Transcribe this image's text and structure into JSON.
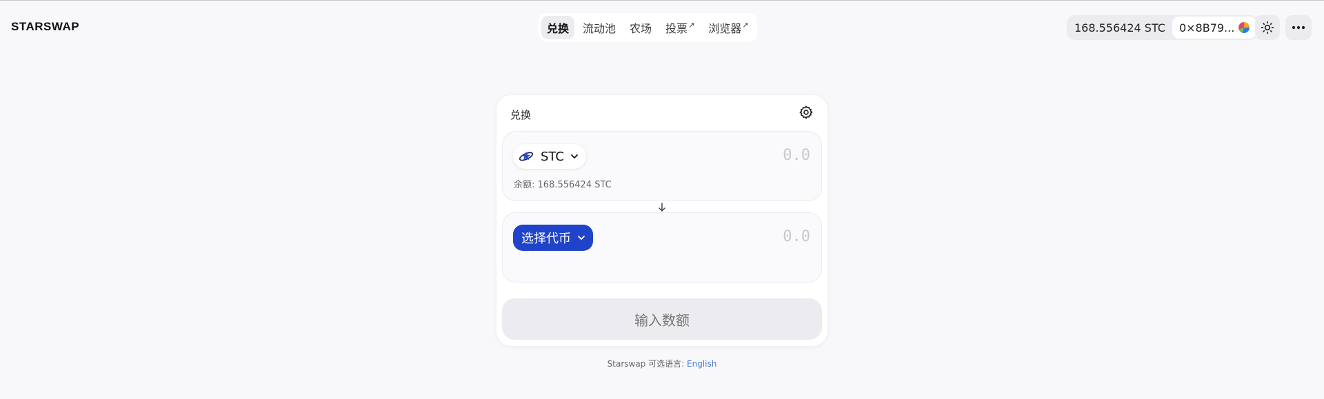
{
  "app": {
    "logo": "STARSWAP"
  },
  "nav": {
    "items": [
      {
        "label": "兑换",
        "active": true,
        "external": false
      },
      {
        "label": "流动池",
        "active": false,
        "external": false
      },
      {
        "label": "农场",
        "active": false,
        "external": false
      },
      {
        "label": "投票",
        "active": false,
        "external": true
      },
      {
        "label": "浏览器",
        "active": false,
        "external": true
      }
    ],
    "external_glyph": "↗"
  },
  "account": {
    "balance": "168.556424 STC",
    "address": "0×8B79..."
  },
  "header_icons": {
    "theme": "sun-icon",
    "more": "more-dots-icon"
  },
  "swap": {
    "title": "兑换",
    "from": {
      "token": "STC",
      "amount_placeholder": "0.0",
      "balance_label": "余额:",
      "balance_value": "168.556424 STC"
    },
    "to": {
      "select_label": "选择代币",
      "amount_placeholder": "0.0"
    },
    "submit_label": "输入数额"
  },
  "footer": {
    "text": "Starswap 可选语言:",
    "language_link": "English"
  },
  "colors": {
    "accent": "#1f44c9",
    "background": "#f8f8fb",
    "link": "#4a7ad8"
  }
}
